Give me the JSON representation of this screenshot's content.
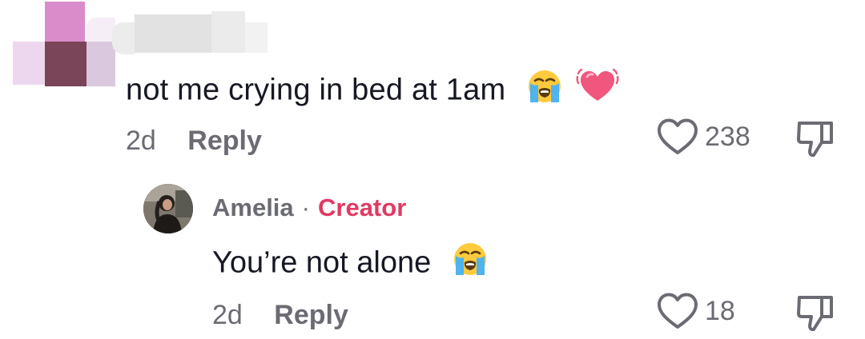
{
  "comment": {
    "text": "not me crying in bed at 1am",
    "emojis": [
      "loudly-crying-face-icon",
      "beating-heart-icon"
    ],
    "time": "2d",
    "reply_label": "Reply",
    "like_count": "238"
  },
  "reply": {
    "author": "Amelia",
    "separator": "·",
    "badge": "Creator",
    "text": "You’re not alone",
    "emojis": [
      "loudly-crying-face-icon"
    ],
    "time": "2d",
    "reply_label": "Reply",
    "like_count": "18"
  },
  "colors": {
    "text": "#161823",
    "meta": "#6b6b73",
    "creator_badge": "#e03a62",
    "heart_emoji": "#f0567e"
  }
}
